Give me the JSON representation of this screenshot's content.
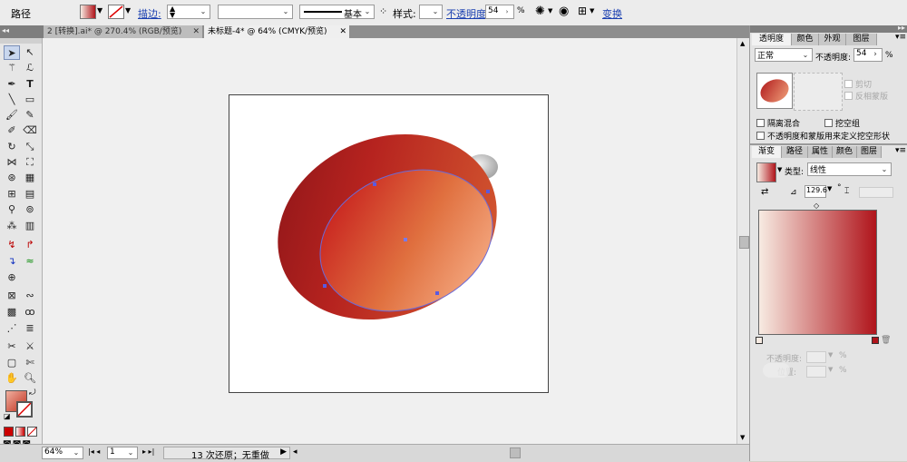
{
  "control_bar": {
    "object_type": "路径",
    "stroke_label": "描边:",
    "stroke_style": "基本",
    "style_label": "样式:",
    "opacity_label": "不透明度:",
    "opacity_value": "54",
    "percent": "%",
    "transform_label": "变换"
  },
  "tabs": [
    {
      "label": "2 [转换].ai* @ 270.4% (RGB/预览)",
      "active": false
    },
    {
      "label": "未标题-4* @ 64% (CMYK/预览)",
      "active": true
    }
  ],
  "status_bar": {
    "zoom": "64%",
    "artboard": "1",
    "history": "13 次还原；无重做"
  },
  "transparency_panel": {
    "tabs": [
      "透明度",
      "颜色",
      "外观",
      "图层"
    ],
    "blend_mode": "正常",
    "opacity_label": "不透明度:",
    "opacity_value": "54",
    "percent": "%",
    "clip_label": "剪切",
    "invert_mask_label": "反相蒙版",
    "isolate_blending_label": "隔离混合",
    "knockout_group_label": "挖空组",
    "opacity_mask_label": "不透明度和蒙版用来定义挖空形状"
  },
  "gradient_panel": {
    "tabs": [
      "渐变",
      "路径",
      "属性",
      "颜色",
      "图层"
    ],
    "type_label": "类型:",
    "type_value": "线性",
    "angle_value": "129.6",
    "degree": "°",
    "stop_opacity_label": "不透明度:",
    "location_label": "位置:"
  },
  "colors": {
    "gradient_light": "#f7ebe2",
    "gradient_dark": "#b0141b",
    "selection_blue": "#5a5ae0"
  }
}
